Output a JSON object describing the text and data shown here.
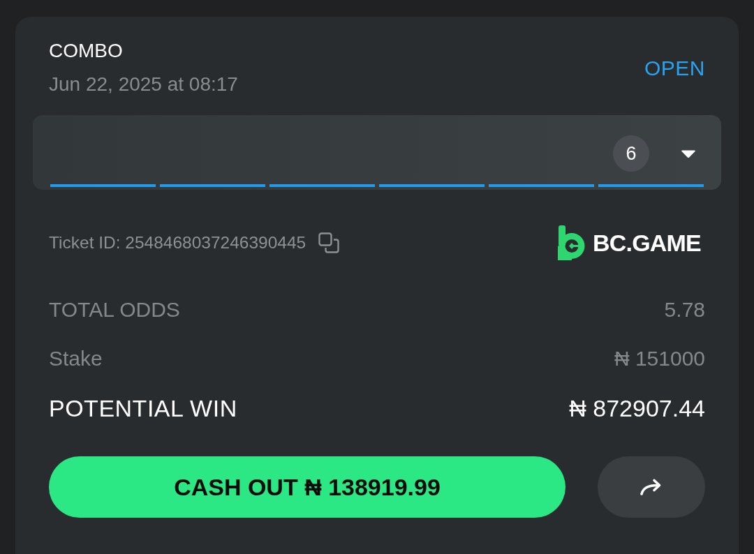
{
  "ticket": {
    "type_label": "COMBO",
    "placed_at": "Jun 22, 2025 at 08:17",
    "status": "OPEN"
  },
  "legs_panel": {
    "count": "6",
    "expanded": false,
    "segments": [
      {
        "kind": "open"
      },
      {
        "kind": "open"
      },
      {
        "kind": "open"
      },
      {
        "kind": "open"
      },
      {
        "kind": "open"
      },
      {
        "kind": "open"
      }
    ]
  },
  "ticket_id": "Ticket ID: 2548468037246390445",
  "brand": {
    "name": "BC.GAME"
  },
  "summary": [
    {
      "kind": "muted",
      "label": "TOTAL ODDS",
      "value": "5.78"
    },
    {
      "kind": "muted",
      "label": "Stake",
      "value": "₦ 151000"
    },
    {
      "kind": "emphasis",
      "label": "POTENTIAL WIN",
      "value": "₦ 872907.44"
    }
  ],
  "actions": {
    "cash_out": "CASH OUT ₦ 138919.99"
  }
}
